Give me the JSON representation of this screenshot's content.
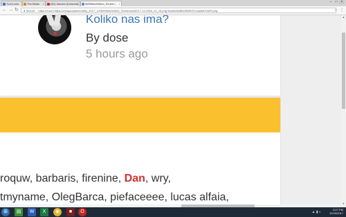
{
  "browser": {
    "tabs": [
      {
        "label": "7com.com",
        "color": "#3b7dd8"
      },
      {
        "label": "The Bbalo",
        "color": "#e57c1f"
      },
      {
        "label": "(60) Jakuzin (Krasnoe)",
        "color": "#d32f2f"
      },
      {
        "label": "5ef9b5a2e0bec_Screen…",
        "color": "#5b8def"
      }
    ],
    "close_glyph": "×",
    "secure_label": "Secure",
    "url": "https://forum.tiaka.com/uploads/monthly_2017_12/5ef9b5a2e0bec_Screenshot2017-12-2303_24_15.png.9aae5d5e8bef5d9b97c1aa5ef10b09.png",
    "back_glyph": "←",
    "forward_glyph": "→",
    "reload_glyph": "↻",
    "star_glyph": "☆",
    "menu_glyph": "⋮"
  },
  "post": {
    "title": "Koliko nas ima?",
    "byline": "By dose",
    "time": "5 hours ago"
  },
  "online": {
    "line1_before": "roquw, barbaris, firenine, ",
    "line1_highlight": "Dan",
    "line1_after": ", wry,",
    "line2": "tmyname, OlegBarca, piefaceeee, lucas alfaia,"
  },
  "colors": {
    "accent_yellow": "#fbc02d",
    "link_blue": "#3a74b5",
    "highlight_red": "#d32f2f"
  },
  "taskbar": {
    "time": "3:27 PM",
    "date": "12/29/2017"
  }
}
